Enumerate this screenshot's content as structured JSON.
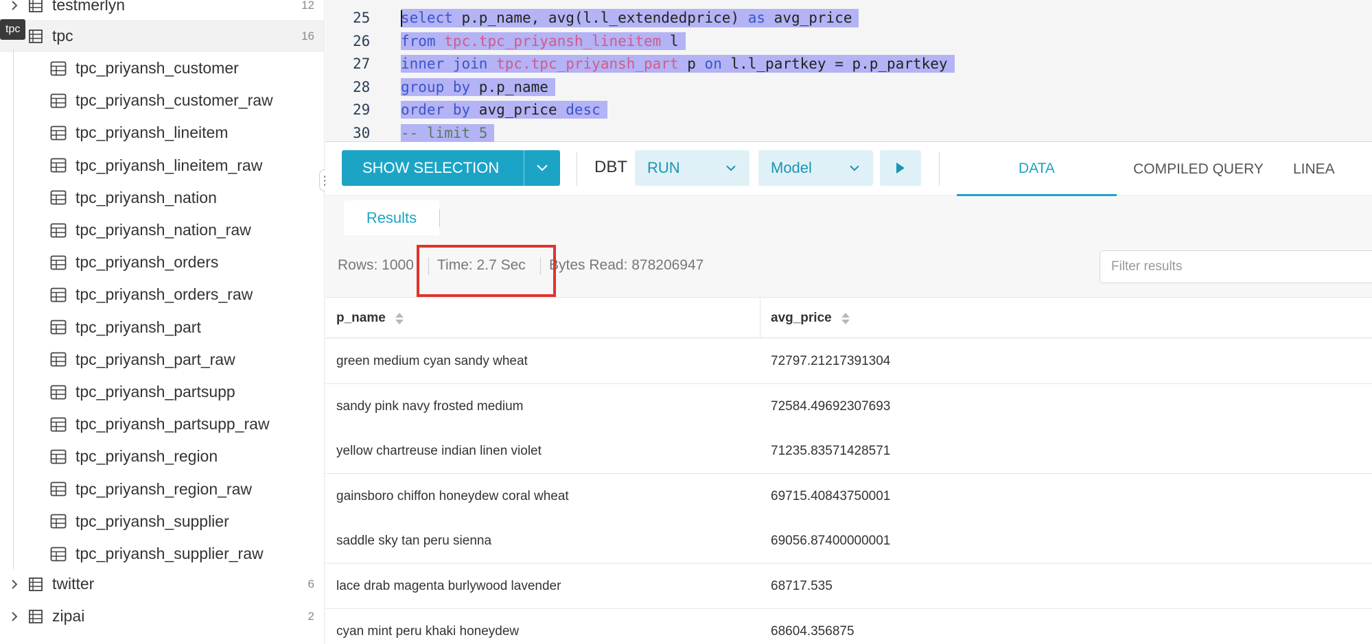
{
  "sidebar": {
    "tooltip": "tpc",
    "schemas_top": [
      {
        "label": "testmerlyn",
        "count": "12"
      },
      {
        "label": "tpc",
        "count": "16"
      }
    ],
    "tables": [
      "tpc_priyansh_customer",
      "tpc_priyansh_customer_raw",
      "tpc_priyansh_lineitem",
      "tpc_priyansh_lineitem_raw",
      "tpc_priyansh_nation",
      "tpc_priyansh_nation_raw",
      "tpc_priyansh_orders",
      "tpc_priyansh_orders_raw",
      "tpc_priyansh_part",
      "tpc_priyansh_part_raw",
      "tpc_priyansh_partsupp",
      "tpc_priyansh_partsupp_raw",
      "tpc_priyansh_region",
      "tpc_priyansh_region_raw",
      "tpc_priyansh_supplier",
      "tpc_priyansh_supplier_raw"
    ],
    "schemas_bottom": [
      {
        "label": "twitter",
        "count": "6"
      },
      {
        "label": "zipai",
        "count": "2"
      }
    ]
  },
  "editor": {
    "lines": [
      {
        "no": "25",
        "parts": [
          {
            "t": "select",
            "c": "kw"
          },
          {
            "t": " p.p_name, avg(l.l_extendedprice) ",
            "c": "ident"
          },
          {
            "t": "as",
            "c": "kw"
          },
          {
            "t": " avg_price",
            "c": "ident"
          }
        ]
      },
      {
        "no": "26",
        "parts": [
          {
            "t": "from",
            "c": "kw"
          },
          {
            "t": " ",
            "c": "ident"
          },
          {
            "t": "tpc.tpc_priyansh_lineitem",
            "c": "tbl"
          },
          {
            "t": " l",
            "c": "ident"
          }
        ]
      },
      {
        "no": "27",
        "parts": [
          {
            "t": "inner join",
            "c": "kw"
          },
          {
            "t": " ",
            "c": "ident"
          },
          {
            "t": "tpc.tpc_priyansh_part",
            "c": "tbl"
          },
          {
            "t": " p ",
            "c": "ident"
          },
          {
            "t": "on",
            "c": "kw"
          },
          {
            "t": " l.l_partkey = p.p_partkey",
            "c": "ident"
          }
        ]
      },
      {
        "no": "28",
        "parts": [
          {
            "t": "group by",
            "c": "kw"
          },
          {
            "t": " p.p_name",
            "c": "ident"
          }
        ]
      },
      {
        "no": "29",
        "parts": [
          {
            "t": "order by",
            "c": "kw"
          },
          {
            "t": " avg_price ",
            "c": "ident"
          },
          {
            "t": "desc",
            "c": "kw"
          }
        ]
      },
      {
        "no": "30",
        "parts": [
          {
            "t": "-- limit 5",
            "c": "cmt"
          }
        ]
      }
    ]
  },
  "toolbar": {
    "show_selection": "SHOW SELECTION",
    "dbt": "DBT",
    "run": "RUN",
    "model": "Model",
    "tabs": [
      "DATA",
      "COMPILED QUERY",
      "LINEA"
    ]
  },
  "results": {
    "tab": "Results",
    "rows_stat": "Rows: 1000",
    "time_stat": "Time: 2.7 Sec",
    "bytes_stat": "Bytes Read: 878206947",
    "filter_placeholder": "Filter results",
    "columns": [
      "p_name",
      "avg_price"
    ],
    "rows": [
      [
        "green medium cyan sandy wheat",
        "72797.21217391304"
      ],
      [
        "sandy pink navy frosted medium",
        "72584.49692307693"
      ],
      [
        "yellow chartreuse indian linen violet",
        "71235.83571428571"
      ],
      [
        "gainsboro chiffon honeydew coral wheat",
        "69715.40843750001"
      ],
      [
        "saddle sky tan peru sienna",
        "69056.87400000001"
      ],
      [
        "lace drab magenta burlywood lavender",
        "68717.535"
      ],
      [
        "cyan mint peru khaki honeydew",
        "68604.356875"
      ]
    ]
  },
  "colors": {
    "accent": "#1ca4c7",
    "highlight": "#e0332a",
    "selection": "#b3b3f5"
  }
}
